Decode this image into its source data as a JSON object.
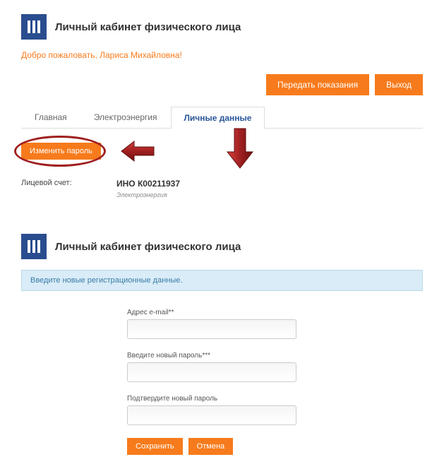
{
  "header": {
    "title": "Личный кабинет физического лица",
    "welcome": "Добро пожаловать, Лариса Михайловна!"
  },
  "topButtons": {
    "submit_readings": "Передать показания",
    "logout": "Выход"
  },
  "tabs": {
    "main": "Главная",
    "energy": "Электроэнергия",
    "personal": "Личные данные"
  },
  "changePassword": {
    "button": "Изменить пароль"
  },
  "account": {
    "label": "Лицевой счет:",
    "value": "ИНО К00211937",
    "sub": "Электроэнергия"
  },
  "lower": {
    "title": "Личный кабинет физического лица",
    "info": "Введите новые регистрационные данные."
  },
  "form": {
    "email_label": "Адрес e-mail**",
    "password_label": "Введите новый пароль***",
    "confirm_label": "Подтвердите новый пароль",
    "save": "Сохранить",
    "cancel": "Отмена"
  }
}
